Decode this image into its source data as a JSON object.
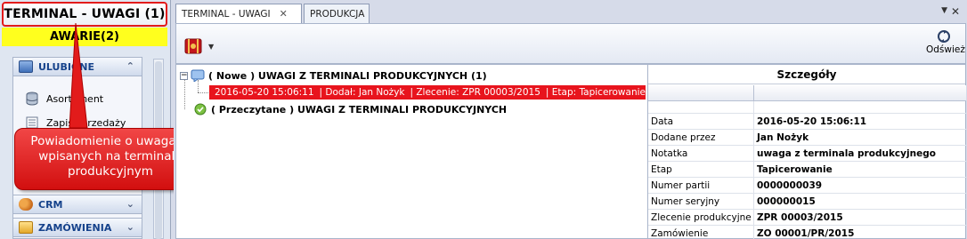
{
  "left": {
    "terminal_button": "TERMINAL - UWAGI (1)",
    "awarie": "AWARIE(2)",
    "groups": [
      {
        "label": "ULUBIONE"
      },
      {
        "label": "CRM"
      },
      {
        "label": "ZAMÓWIENIA"
      }
    ],
    "items": [
      {
        "label": "Asortyment"
      },
      {
        "label": "Zapis sprzedaży"
      }
    ]
  },
  "callout": {
    "text": "Powiadomienie o uwagach wpisanych na terminalu produkcyjnym"
  },
  "tabs": [
    {
      "label": "TERMINAL - UWAGI",
      "close": "✕"
    },
    {
      "label": "PRODUKCJA"
    }
  ],
  "toolbar": {
    "refresh_label": "Odśwież"
  },
  "tree": {
    "nodes": [
      {
        "label": "( Nowe ) UWAGI Z TERMINALI PRODUKCYJNYCH (1)"
      },
      {
        "label": "( Przeczytane ) UWAGI Z TERMINALI PRODUKCYJNYCH"
      }
    ],
    "selected": {
      "date": "2016-05-20 15:06:11",
      "added": "| Dodał:   Jan Nożyk",
      "order": "| Zlecenie:   ZPR 00003/2015",
      "stage": "| Etap:   Tapicerowanie ..."
    }
  },
  "details": {
    "title": "Szczegóły",
    "rows": [
      {
        "key": "Data",
        "value": "2016-05-20 15:06:11"
      },
      {
        "key": "Dodane przez",
        "value": "Jan Nożyk"
      },
      {
        "key": "Notatka",
        "value": "uwaga z terminala produkcyjnego"
      },
      {
        "key": "Etap",
        "value": "Tapicerowanie"
      },
      {
        "key": "Numer partii",
        "value": "0000000039"
      },
      {
        "key": "Numer seryjny",
        "value": "000000015"
      },
      {
        "key": "Zlecenie produkcyjne",
        "value": "ZPR 00003/2015"
      },
      {
        "key": "Zamówienie",
        "value": "ZO 00001/PR/2015"
      }
    ]
  },
  "colors": {
    "accent_red": "#e8141d",
    "awarie_yellow": "#ffff1e"
  }
}
